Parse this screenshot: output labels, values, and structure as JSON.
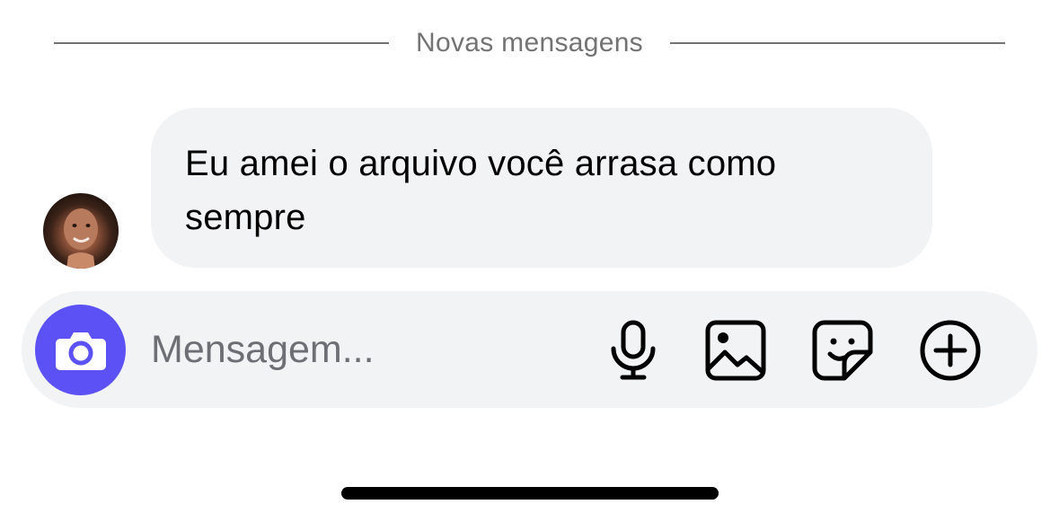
{
  "divider": {
    "label": "Novas mensagens"
  },
  "message": {
    "text": "Eu amei o arquivo você arrasa como sempre",
    "bubble_color": "#f2f3f5"
  },
  "composer": {
    "placeholder": "Mensagem...",
    "camera_color": "#5b51f5",
    "icons": [
      "camera-icon",
      "microphone-icon",
      "gallery-icon",
      "sticker-icon",
      "plus-circle-icon"
    ]
  }
}
